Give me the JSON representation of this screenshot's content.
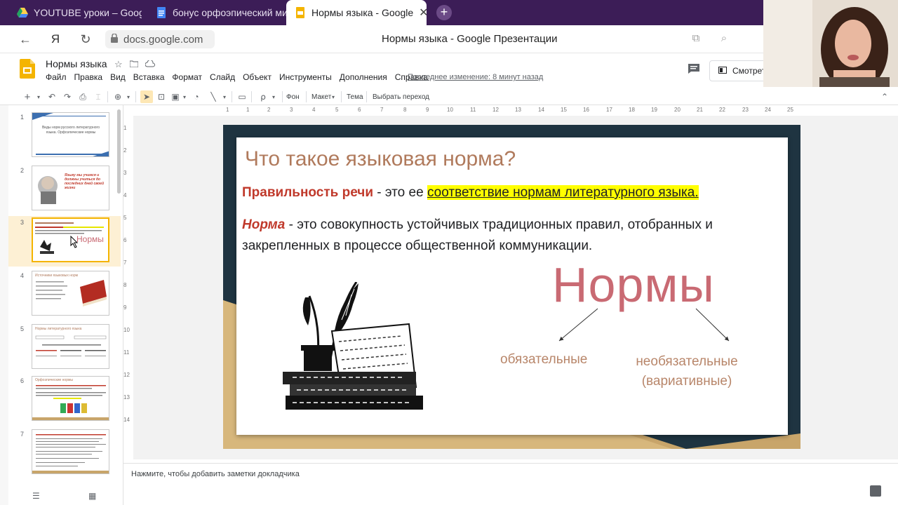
{
  "browser": {
    "tabs": [
      {
        "title": "YOUTUBE уроки – Google",
        "icon": "google-drive-icon"
      },
      {
        "title": "бонус орфоэпический ми",
        "icon": "google-docs-icon"
      },
      {
        "title": "Нормы языка - Google",
        "icon": "google-slides-icon",
        "active": true
      }
    ],
    "url": "docs.google.com",
    "page_title": "Нормы языка - Google Презентации"
  },
  "docs": {
    "title": "Нормы языка",
    "menu": [
      "Файл",
      "Правка",
      "Вид",
      "Вставка",
      "Формат",
      "Слайд",
      "Объект",
      "Инструменты",
      "Дополнения",
      "Справка"
    ],
    "last_edit": "Последнее изменение: 8 минут назад",
    "view_button": "Смотреть"
  },
  "toolbar": {
    "background": "Фон",
    "layout": "Макет",
    "theme": "Тема",
    "transition": "Выбрать переход"
  },
  "ruler": {
    "horizontal": [
      "1",
      "1",
      "2",
      "3",
      "4",
      "5",
      "6",
      "7",
      "8",
      "9",
      "10",
      "11",
      "12",
      "13",
      "14",
      "15",
      "16",
      "17",
      "18",
      "19",
      "20",
      "21",
      "22",
      "23",
      "24",
      "25"
    ],
    "vertical": [
      "1",
      "2",
      "3",
      "4",
      "5",
      "6",
      "7",
      "8",
      "9",
      "10",
      "11",
      "12",
      "13",
      "14"
    ]
  },
  "filmstrip": {
    "slides": [
      {
        "number": "1",
        "caption": "Виды норм русского литературного языка. Орфоэпические нормы"
      },
      {
        "number": "2",
        "caption": "Языку мы учимся и должны учиться до последних дней своей жизни"
      },
      {
        "number": "3",
        "caption": "Нормы"
      },
      {
        "number": "4",
        "caption": "Источники языковых норм"
      },
      {
        "number": "5",
        "caption": "Нормы литературного языка"
      },
      {
        "number": "6",
        "caption": "Орфоэпические нормы"
      },
      {
        "number": "7",
        "caption": ""
      }
    ],
    "selected": 3
  },
  "slide": {
    "title": "Что такое языковая норма?",
    "p1_term": "Правильность речи",
    "p1_mid": " - это ее ",
    "p1_highlight": "соответствие нормам литературного языка.",
    "p2_term": "Норма",
    "p2_rest": " - это совокупность устойчивых традиционных правил, отобранных и закрепленных в процессе общественной коммуникации.",
    "big_word": "Нормы",
    "left_branch": "обязательные",
    "right_branch_1": "необязательные",
    "right_branch_2": "(вариативные)"
  },
  "notes": {
    "placeholder": "Нажмите, чтобы добавить заметки докладчика"
  },
  "colors": {
    "accent_title": "#b07a5c",
    "accent_red": "#c0392b",
    "highlight": "#ffff00",
    "big_word": "#c96a73",
    "slide_dark": "#1f3441",
    "slide_gold": "#c8a56a"
  }
}
